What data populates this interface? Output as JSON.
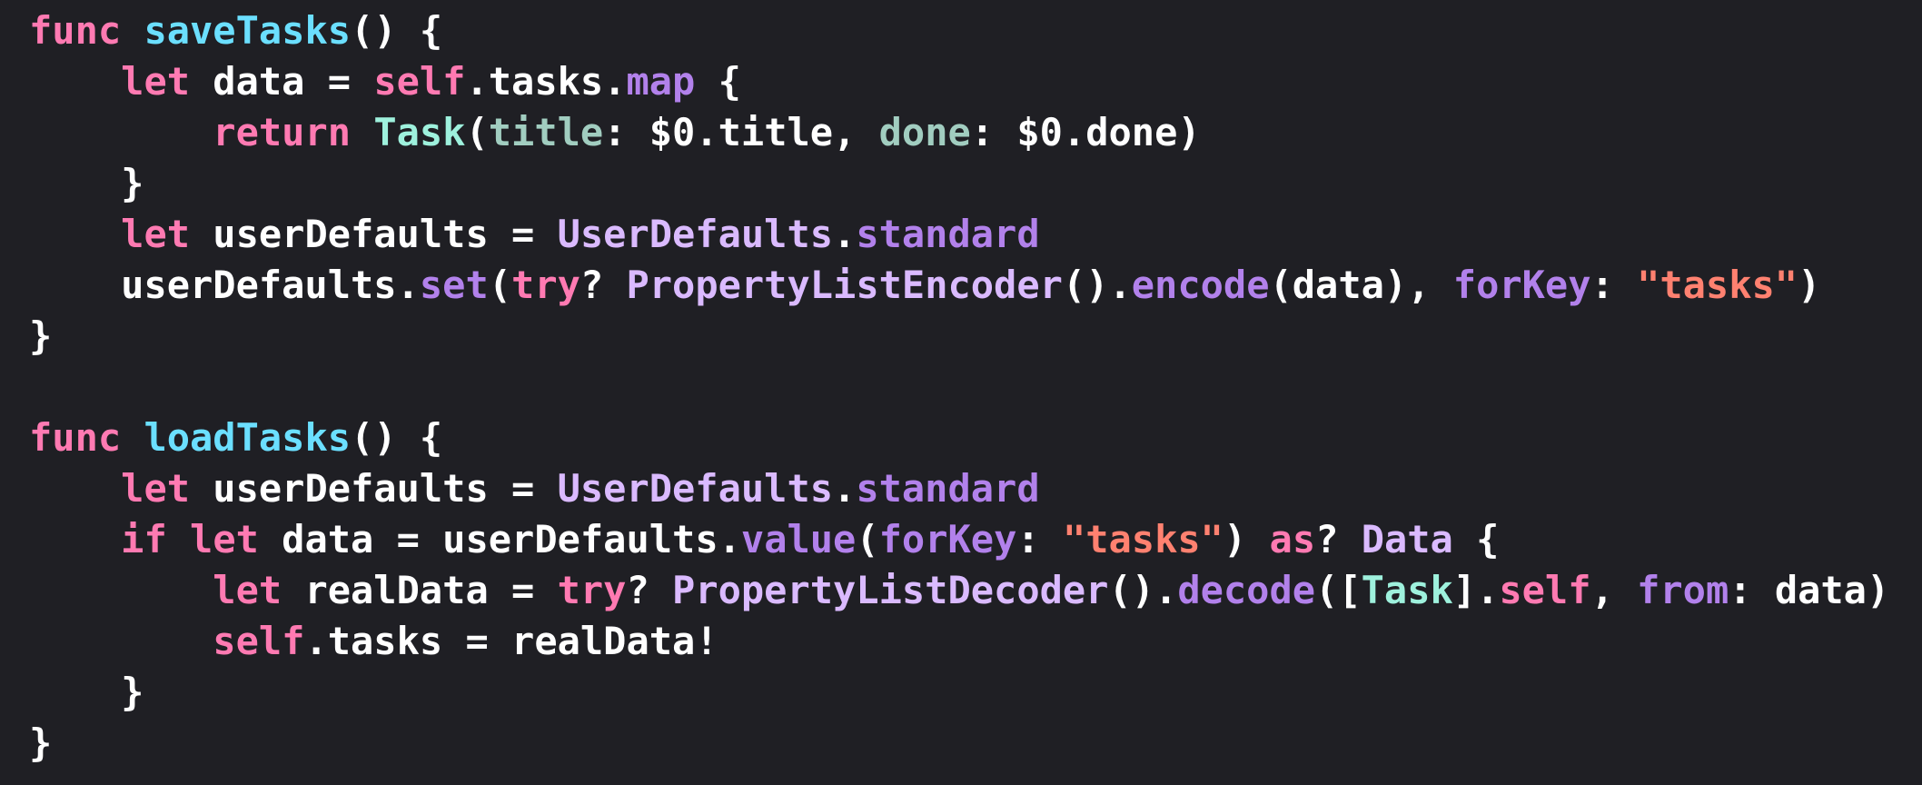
{
  "colors": {
    "background": "#1f1f24",
    "plain": "#ffffff",
    "keyword": "#ff7ab2",
    "declaration": "#6bdfff",
    "type": "#dabaff",
    "method": "#b281eb",
    "project_type": "#9ef1dd",
    "parameter": "#a1cdc0",
    "string": "#ff8170"
  },
  "lines": [
    [
      [
        "kw",
        "func"
      ],
      [
        "p",
        " "
      ],
      [
        "decl",
        "saveTasks"
      ],
      [
        "p",
        "() {"
      ]
    ],
    [
      [
        "p",
        "    "
      ],
      [
        "kw",
        "let"
      ],
      [
        "p",
        " data = "
      ],
      [
        "kw",
        "self"
      ],
      [
        "p",
        ".tasks."
      ],
      [
        "fn",
        "map"
      ],
      [
        "p",
        " {"
      ]
    ],
    [
      [
        "p",
        "        "
      ],
      [
        "kw",
        "return"
      ],
      [
        "p",
        " "
      ],
      [
        "ptype",
        "Task"
      ],
      [
        "p",
        "("
      ],
      [
        "param",
        "title"
      ],
      [
        "p",
        ": $0.title, "
      ],
      [
        "param",
        "done"
      ],
      [
        "p",
        ": $0.done)"
      ]
    ],
    [
      [
        "p",
        "    }"
      ]
    ],
    [
      [
        "p",
        "    "
      ],
      [
        "kw",
        "let"
      ],
      [
        "p",
        " userDefaults = "
      ],
      [
        "type",
        "UserDefaults"
      ],
      [
        "p",
        "."
      ],
      [
        "fn",
        "standard"
      ]
    ],
    [
      [
        "p",
        "    userDefaults."
      ],
      [
        "fn",
        "set"
      ],
      [
        "p",
        "("
      ],
      [
        "kw",
        "try"
      ],
      [
        "p",
        "? "
      ],
      [
        "type",
        "PropertyListEncoder"
      ],
      [
        "p",
        "()."
      ],
      [
        "fn",
        "encode"
      ],
      [
        "p",
        "(data), "
      ],
      [
        "fn",
        "forKey"
      ],
      [
        "p",
        ": "
      ],
      [
        "str",
        "\"tasks\""
      ],
      [
        "p",
        ")"
      ]
    ],
    [
      [
        "p",
        "}"
      ]
    ],
    [],
    [
      [
        "kw",
        "func"
      ],
      [
        "p",
        " "
      ],
      [
        "decl",
        "loadTasks"
      ],
      [
        "p",
        "() {"
      ]
    ],
    [
      [
        "p",
        "    "
      ],
      [
        "kw",
        "let"
      ],
      [
        "p",
        " userDefaults = "
      ],
      [
        "type",
        "UserDefaults"
      ],
      [
        "p",
        "."
      ],
      [
        "fn",
        "standard"
      ]
    ],
    [
      [
        "p",
        "    "
      ],
      [
        "kw",
        "if"
      ],
      [
        "p",
        " "
      ],
      [
        "kw",
        "let"
      ],
      [
        "p",
        " data = userDefaults."
      ],
      [
        "fn",
        "value"
      ],
      [
        "p",
        "("
      ],
      [
        "fn",
        "forKey"
      ],
      [
        "p",
        ": "
      ],
      [
        "str",
        "\"tasks\""
      ],
      [
        "p",
        ") "
      ],
      [
        "kw",
        "as"
      ],
      [
        "p",
        "? "
      ],
      [
        "type",
        "Data"
      ],
      [
        "p",
        " {"
      ]
    ],
    [
      [
        "p",
        "        "
      ],
      [
        "kw",
        "let"
      ],
      [
        "p",
        " realData = "
      ],
      [
        "kw",
        "try"
      ],
      [
        "p",
        "? "
      ],
      [
        "type",
        "PropertyListDecoder"
      ],
      [
        "p",
        "()."
      ],
      [
        "fn",
        "decode"
      ],
      [
        "p",
        "(["
      ],
      [
        "ptype",
        "Task"
      ],
      [
        "p",
        "]."
      ],
      [
        "kw",
        "self"
      ],
      [
        "p",
        ", "
      ],
      [
        "fn",
        "from"
      ],
      [
        "p",
        ": data)"
      ]
    ],
    [
      [
        "p",
        "        "
      ],
      [
        "kw",
        "self"
      ],
      [
        "p",
        ".tasks = realData!"
      ]
    ],
    [
      [
        "p",
        "    }"
      ]
    ],
    [
      [
        "p",
        "}"
      ]
    ]
  ]
}
